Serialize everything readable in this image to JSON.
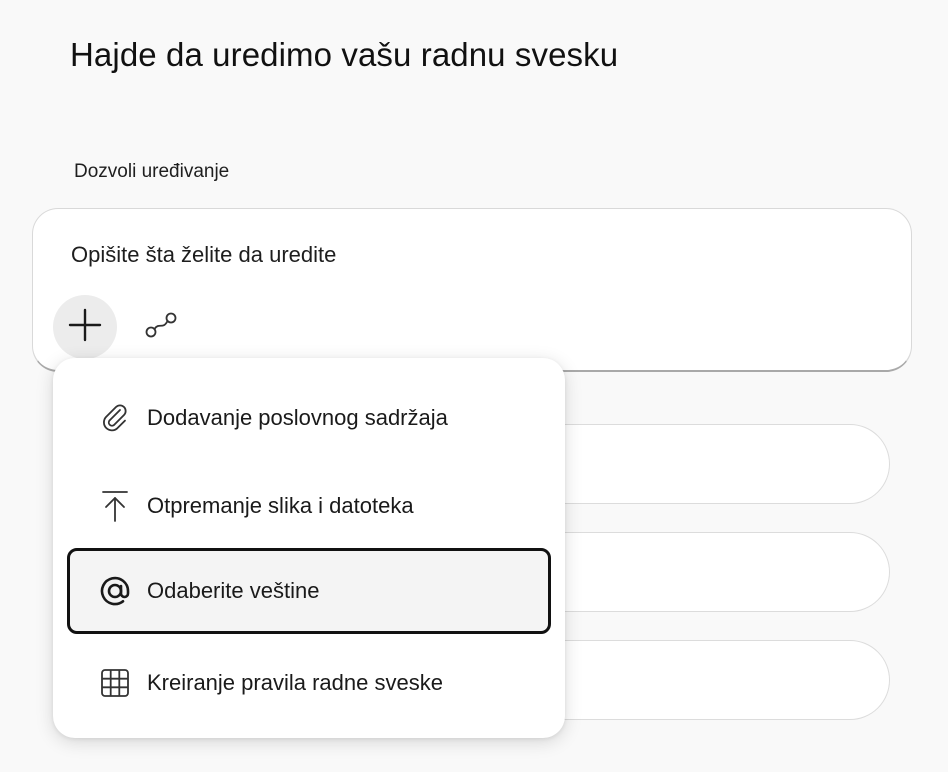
{
  "header": {
    "title": "Hajde da uredimo vašu radnu svesku"
  },
  "section": {
    "label": "Dozvoli uređivanje"
  },
  "prompt": {
    "placeholder": "Opišite šta želite da uredite",
    "add_icon": "plus-icon",
    "connector_icon": "connector-icon"
  },
  "menu": {
    "items": [
      {
        "label": "Dodavanje poslovnog sadržaja",
        "icon": "paperclip-icon",
        "selected": false
      },
      {
        "label": "Otpremanje slika i datoteka",
        "icon": "upload-icon",
        "selected": false
      },
      {
        "label": "Odaberite veštine",
        "icon": "at-sign-icon",
        "selected": true
      },
      {
        "label": "Kreiranje pravila radne sveske",
        "icon": "table-grid-icon",
        "selected": false
      }
    ]
  },
  "colors": {
    "background": "#f9f9f9",
    "card": "#ffffff",
    "selected_border": "#111111",
    "selected_fill": "#f4f4f4",
    "plus_button_fill": "#ececec"
  }
}
